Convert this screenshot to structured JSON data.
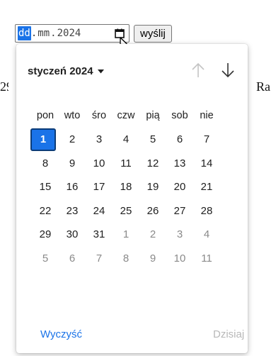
{
  "background": {
    "left_fragment": "29",
    "right_fragment": "Ra"
  },
  "date_input": {
    "segments": [
      "dd",
      "mm",
      "2024"
    ],
    "separator": "."
  },
  "submit_label": "wyślij",
  "picker": {
    "month_label": "styczeń 2024",
    "weekdays": [
      "pon",
      "wto",
      "śro",
      "czw",
      "pią",
      "sob",
      "nie"
    ],
    "weeks": [
      [
        1,
        2,
        3,
        4,
        5,
        6,
        7
      ],
      [
        8,
        9,
        10,
        11,
        12,
        13,
        14
      ],
      [
        15,
        16,
        17,
        18,
        19,
        20,
        21
      ],
      [
        22,
        23,
        24,
        25,
        26,
        27,
        28
      ],
      [
        29,
        30,
        31,
        1,
        2,
        3,
        4
      ],
      [
        5,
        6,
        7,
        8,
        9,
        10,
        11
      ]
    ],
    "selected_day": 1,
    "clear_label": "Wyczyść",
    "today_label": "Dzisiaj"
  },
  "colors": {
    "accent": "#1a73e8",
    "muted": "#8a8a8a",
    "disabled": "#b8b8b8"
  },
  "icons": [
    "calendar-icon",
    "cursor-icon",
    "caret-down-icon",
    "arrow-up-icon",
    "arrow-down-icon"
  ]
}
